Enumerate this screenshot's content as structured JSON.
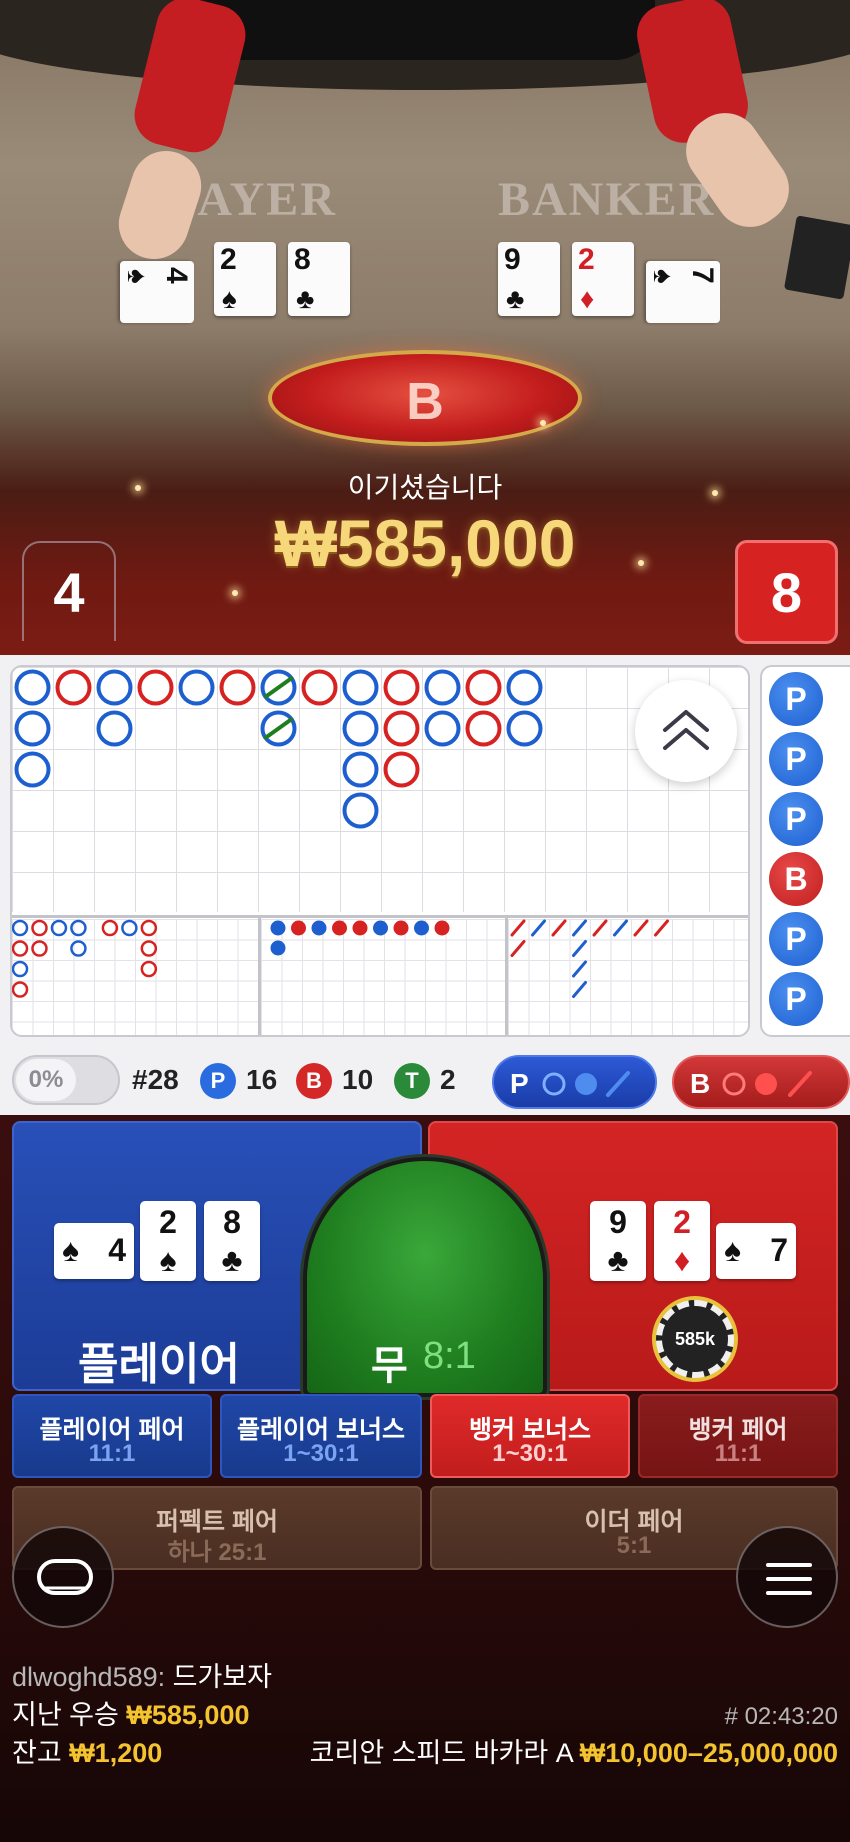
{
  "video": {
    "felt_player": "PLAYER",
    "felt_banker": "BANKER",
    "result_letter": "B",
    "win_message": "이기셨습니다",
    "win_amount": "₩585,000",
    "player_score": "4",
    "banker_score": "8",
    "player_cards": [
      {
        "rank": "4",
        "suit": "♠",
        "color": "#111111"
      },
      {
        "rank": "2",
        "suit": "♠",
        "color": "#111111"
      },
      {
        "rank": "8",
        "suit": "♣",
        "color": "#111111"
      }
    ],
    "banker_cards": [
      {
        "rank": "9",
        "suit": "♣",
        "color": "#111111"
      },
      {
        "rank": "2",
        "suit": "♦",
        "color": "#d11f25"
      },
      {
        "rank": "7",
        "suit": "♠",
        "color": "#111111"
      }
    ]
  },
  "roadmap": {
    "collapse_icon": "double-chevron-up-icon",
    "bead_road": [
      "P",
      "P",
      "P",
      "B",
      "P",
      "P"
    ],
    "stats": {
      "percent_label": "0%",
      "round": "#28",
      "player_letter": "P",
      "player_count": "16",
      "banker_letter": "B",
      "banker_count": "10",
      "tie_letter": "T",
      "tie_count": "2"
    },
    "predict_player_label": "P",
    "predict_banker_label": "B"
  },
  "colors": {
    "player_blue": "#1e5fd0",
    "banker_red": "#d72222",
    "tie_green": "#1f7e1f",
    "gold": "#f4c430"
  },
  "betting": {
    "player_label": "플레이어",
    "tie_label": "무",
    "tie_odds": "8:1",
    "chip_value": "585k",
    "side_bets": [
      {
        "name": "플레이어 페어",
        "odds": "11:1"
      },
      {
        "name": "플레이어 보너스",
        "odds": "1~30:1"
      },
      {
        "name": "뱅커 보너스",
        "odds": "1~30:1"
      },
      {
        "name": "뱅커 페어",
        "odds": "11:1"
      },
      {
        "name": "퍼펙트 페어",
        "odds": "하나 25:1"
      },
      {
        "name": "이더 페어",
        "odds": "5:1"
      }
    ]
  },
  "chat": {
    "user": "dlwoghd589:",
    "message": "드가보자"
  },
  "footer": {
    "last_win_label": "지난 우승",
    "last_win_amount": "₩585,000",
    "round_id": "# 02:43:20",
    "balance_label": "잔고",
    "balance_amount": "₩1,200",
    "table_name": "코리안 스피드 바카라 A",
    "limits": "₩10,000–25,000,000"
  }
}
